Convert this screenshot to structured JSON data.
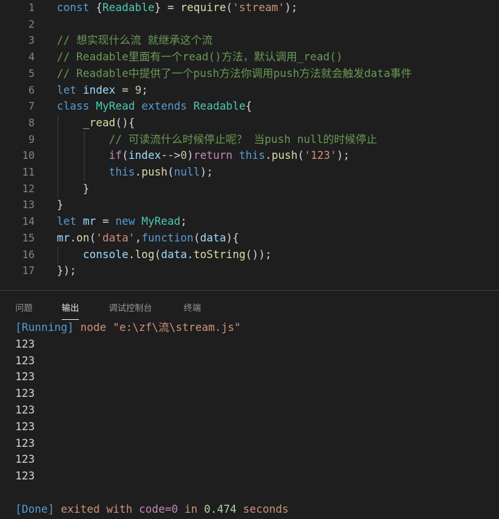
{
  "editor": {
    "lines": [
      {
        "num": "1",
        "tokens": [
          [
            "kw",
            "const "
          ],
          [
            "punc",
            "{"
          ],
          [
            "cls",
            "Readable"
          ],
          [
            "punc",
            "} = "
          ],
          [
            "fn",
            "require"
          ],
          [
            "punc",
            "("
          ],
          [
            "str",
            "'stream'"
          ],
          [
            "punc",
            ");"
          ]
        ]
      },
      {
        "num": "2",
        "tokens": []
      },
      {
        "num": "3",
        "tokens": [
          [
            "cmt",
            "// 想实现什么流 就继承这个流"
          ]
        ]
      },
      {
        "num": "4",
        "tokens": [
          [
            "cmt",
            "// Readable里面有一个read()方法，默认调用_read()"
          ]
        ]
      },
      {
        "num": "5",
        "tokens": [
          [
            "cmt",
            "// Readable中提供了一个push方法你调用push方法就会触发data事件"
          ]
        ]
      },
      {
        "num": "6",
        "tokens": [
          [
            "kw",
            "let "
          ],
          [
            "var",
            "index"
          ],
          [
            "punc",
            " = "
          ],
          [
            "num",
            "9"
          ],
          [
            "punc",
            ";"
          ]
        ]
      },
      {
        "num": "7",
        "tokens": [
          [
            "kw",
            "class "
          ],
          [
            "cls",
            "MyRead "
          ],
          [
            "kw",
            "extends "
          ],
          [
            "cls",
            "Readable"
          ],
          [
            "punc",
            "{"
          ]
        ]
      },
      {
        "num": "8",
        "tokens": [
          [
            "punc",
            "    "
          ],
          [
            "fn",
            "_read"
          ],
          [
            "punc",
            "(){"
          ]
        ]
      },
      {
        "num": "9",
        "tokens": [
          [
            "punc",
            "        "
          ],
          [
            "cmt",
            "// 可读流什么时候停止呢？ 当push null的时候停止"
          ]
        ]
      },
      {
        "num": "10",
        "tokens": [
          [
            "punc",
            "        "
          ],
          [
            "kw2",
            "if"
          ],
          [
            "punc",
            "("
          ],
          [
            "var",
            "index"
          ],
          [
            "punc",
            "-->"
          ],
          [
            "num",
            "0"
          ],
          [
            "punc",
            ")"
          ],
          [
            "kw2",
            "return "
          ],
          [
            "kw",
            "this"
          ],
          [
            "punc",
            "."
          ],
          [
            "fn",
            "push"
          ],
          [
            "punc",
            "("
          ],
          [
            "str",
            "'123'"
          ],
          [
            "punc",
            ");"
          ]
        ]
      },
      {
        "num": "11",
        "tokens": [
          [
            "punc",
            "        "
          ],
          [
            "kw",
            "this"
          ],
          [
            "punc",
            "."
          ],
          [
            "fn",
            "push"
          ],
          [
            "punc",
            "("
          ],
          [
            "kw",
            "null"
          ],
          [
            "punc",
            ");"
          ]
        ]
      },
      {
        "num": "12",
        "tokens": [
          [
            "punc",
            "    }"
          ]
        ]
      },
      {
        "num": "13",
        "tokens": [
          [
            "punc",
            "}"
          ]
        ]
      },
      {
        "num": "14",
        "tokens": [
          [
            "kw",
            "let "
          ],
          [
            "var",
            "mr"
          ],
          [
            "punc",
            " = "
          ],
          [
            "kw",
            "new "
          ],
          [
            "cls",
            "MyRead"
          ],
          [
            "punc",
            ";"
          ]
        ]
      },
      {
        "num": "15",
        "tokens": [
          [
            "var",
            "mr"
          ],
          [
            "punc",
            "."
          ],
          [
            "fn",
            "on"
          ],
          [
            "punc",
            "("
          ],
          [
            "str",
            "'data'"
          ],
          [
            "punc",
            ","
          ],
          [
            "kw",
            "function"
          ],
          [
            "punc",
            "("
          ],
          [
            "var",
            "data"
          ],
          [
            "punc",
            "){"
          ]
        ]
      },
      {
        "num": "16",
        "tokens": [
          [
            "punc",
            "    "
          ],
          [
            "var",
            "console"
          ],
          [
            "punc",
            "."
          ],
          [
            "fn",
            "log"
          ],
          [
            "punc",
            "("
          ],
          [
            "var",
            "data"
          ],
          [
            "punc",
            "."
          ],
          [
            "fn",
            "toString"
          ],
          [
            "punc",
            "());"
          ]
        ]
      },
      {
        "num": "17",
        "tokens": [
          [
            "punc",
            "});"
          ]
        ]
      }
    ]
  },
  "panel": {
    "tabs": [
      {
        "label": "问题",
        "active": false
      },
      {
        "label": "输出",
        "active": true
      },
      {
        "label": "调试控制台",
        "active": false
      },
      {
        "label": "终端",
        "active": false
      }
    ],
    "run_tag": "[Running]",
    "run_cmd": " node \"e:\\zf\\流\\stream.js\"",
    "output_lines": [
      "123",
      "123",
      "123",
      "123",
      "123",
      "123",
      "123",
      "123",
      "123"
    ],
    "done_tag": "[Done]",
    "done_text_1": " exited with ",
    "done_code": "code=0",
    "done_text_2": " in ",
    "done_seconds": "0.474",
    "done_text_3": " seconds"
  },
  "colors": {
    "background": "#1e1e1e",
    "keyword": "#569cd6",
    "control": "#c586c0",
    "string": "#ce9178",
    "number": "#b5cea8",
    "comment": "#6a9955",
    "variable": "#9cdcfe",
    "function": "#dcdcaa",
    "class": "#4ec9b0"
  }
}
